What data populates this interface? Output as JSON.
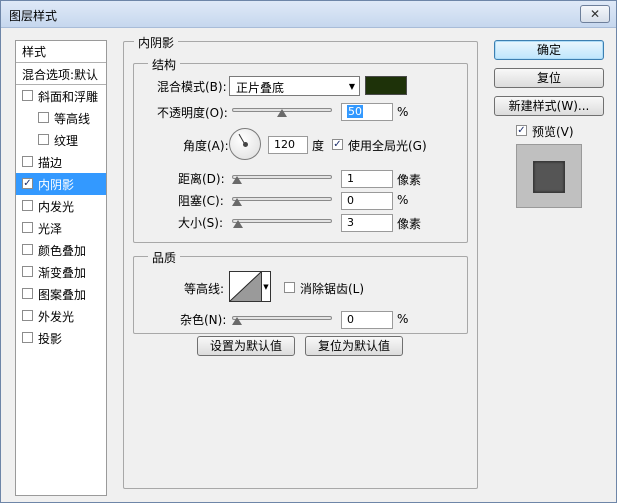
{
  "window": {
    "title": "图层样式",
    "close_glyph": "✕"
  },
  "style_list": {
    "header": "样式",
    "blend_options": "混合选项:默认",
    "items": [
      {
        "label": "斜面和浮雕",
        "checked": false,
        "sub": false,
        "selected": false
      },
      {
        "label": "等高线",
        "checked": false,
        "sub": true,
        "selected": false
      },
      {
        "label": "纹理",
        "checked": false,
        "sub": true,
        "selected": false
      },
      {
        "label": "描边",
        "checked": false,
        "sub": false,
        "selected": false
      },
      {
        "label": "内阴影",
        "checked": true,
        "sub": false,
        "selected": true
      },
      {
        "label": "内发光",
        "checked": false,
        "sub": false,
        "selected": false
      },
      {
        "label": "光泽",
        "checked": false,
        "sub": false,
        "selected": false
      },
      {
        "label": "颜色叠加",
        "checked": false,
        "sub": false,
        "selected": false
      },
      {
        "label": "渐变叠加",
        "checked": false,
        "sub": false,
        "selected": false
      },
      {
        "label": "图案叠加",
        "checked": false,
        "sub": false,
        "selected": false
      },
      {
        "label": "外发光",
        "checked": false,
        "sub": false,
        "selected": false
      },
      {
        "label": "投影",
        "checked": false,
        "sub": false,
        "selected": false
      }
    ]
  },
  "panel": {
    "title": "内阴影",
    "structure": {
      "title": "结构",
      "blend_mode_label": "混合模式(B):",
      "blend_mode_value": "正片叠底",
      "color": "#1e3209",
      "opacity_label": "不透明度(O):",
      "opacity_value": "50",
      "opacity_unit": "%",
      "angle_label": "角度(A):",
      "angle_value": "120",
      "angle_unit": "度",
      "global_light_label": "使用全局光(G)",
      "global_light_checked": true,
      "distance_label": "距离(D):",
      "distance_value": "1",
      "distance_unit": "像素",
      "choke_label": "阻塞(C):",
      "choke_value": "0",
      "choke_unit": "%",
      "size_label": "大小(S):",
      "size_value": "3",
      "size_unit": "像素"
    },
    "quality": {
      "title": "品质",
      "contour_label": "等高线:",
      "antialias_label": "消除锯齿(L)",
      "antialias_checked": false,
      "noise_label": "杂色(N):",
      "noise_value": "0",
      "noise_unit": "%"
    },
    "make_default_label": "设置为默认值",
    "reset_default_label": "复位为默认值"
  },
  "buttons": {
    "ok": "确定",
    "reset": "复位",
    "new_style": "新建样式(W)...",
    "preview_label": "预览(V)",
    "preview_checked": true
  },
  "check_glyph": "✓"
}
